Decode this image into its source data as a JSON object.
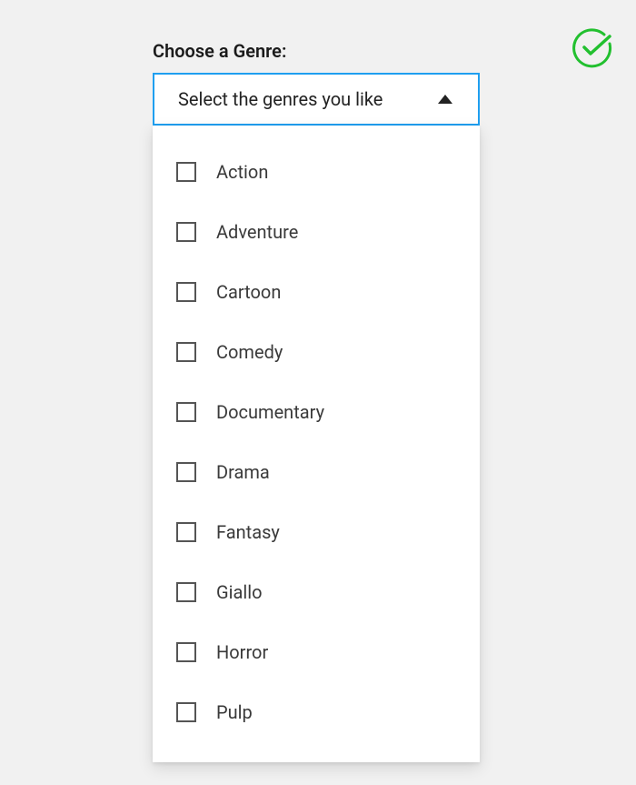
{
  "status_icon": "checkmark-circle",
  "label": "Choose a Genre:",
  "select": {
    "placeholder": "Select the genres you like",
    "expanded": true
  },
  "options": [
    {
      "label": "Action",
      "checked": false
    },
    {
      "label": "Adventure",
      "checked": false
    },
    {
      "label": "Cartoon",
      "checked": false
    },
    {
      "label": "Comedy",
      "checked": false
    },
    {
      "label": "Documentary",
      "checked": false
    },
    {
      "label": "Drama",
      "checked": false
    },
    {
      "label": "Fantasy",
      "checked": false
    },
    {
      "label": "Giallo",
      "checked": false
    },
    {
      "label": "Horror",
      "checked": false
    },
    {
      "label": "Pulp",
      "checked": false
    }
  ],
  "colors": {
    "accent": "#1f9ff0",
    "success": "#22c02f",
    "background": "#f1f1f1"
  }
}
